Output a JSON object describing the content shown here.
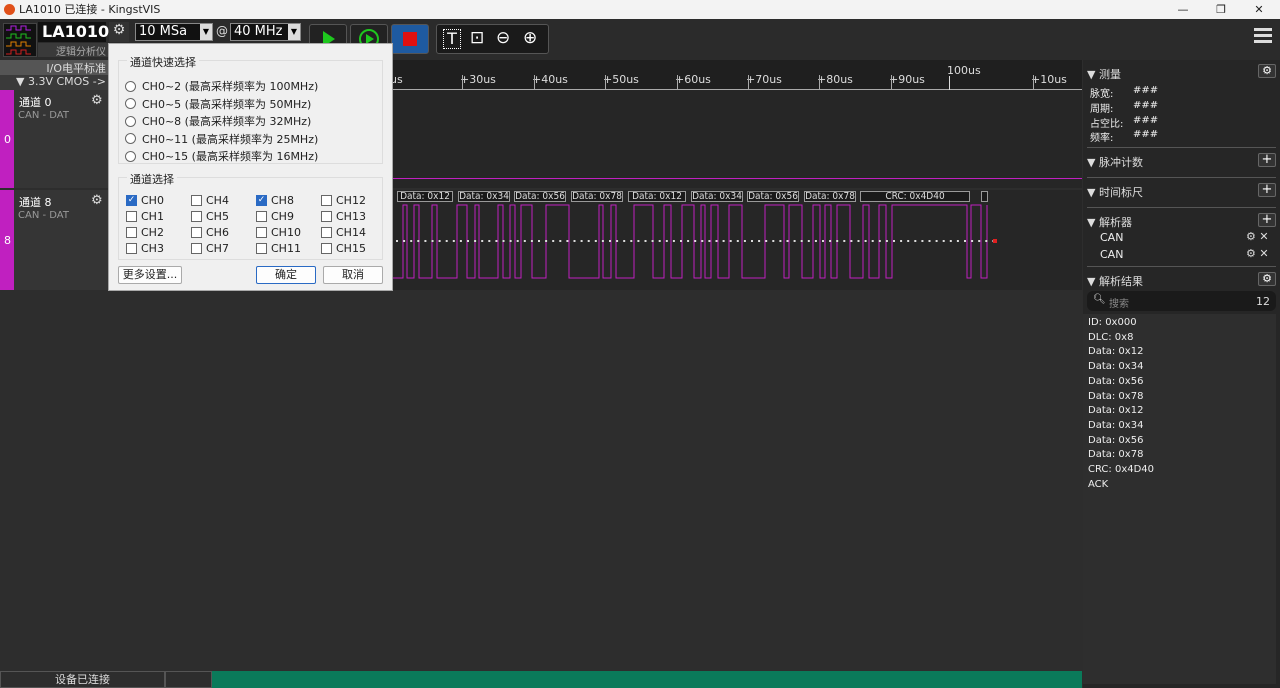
{
  "window": {
    "title": "LA1010 已连接 - KingstVIS",
    "minimize": "—",
    "maximize": "❐",
    "close": "✕"
  },
  "toolbar": {
    "device": "LA1010",
    "device_sub": "逻辑分析仪",
    "sample_depth": "10 MSa",
    "at": "@",
    "sample_rate": "40 MHz"
  },
  "left": {
    "io_standard": "I/O电平标准",
    "voltage": "▼ 3.3V CMOS -> V"
  },
  "channels": [
    {
      "name": "通道 0",
      "sub": "CAN - DAT",
      "index": "0"
    },
    {
      "name": "通道 8",
      "sub": "CAN - DAT",
      "index": "8"
    }
  ],
  "ruler": {
    "labels": [
      "us",
      "+30us",
      "+40us",
      "+50us",
      "+60us",
      "+70us",
      "+80us",
      "+90us",
      "+10us"
    ],
    "major": "100us"
  },
  "decode_labels": [
    "Data: 0x12",
    "Data: 0x34",
    "Data: 0x56",
    "Data: 0x78",
    "Data: 0x12",
    "Data: 0x34",
    "Data: 0x56",
    "Data: 0x78",
    "CRC: 0x4D40"
  ],
  "dialog": {
    "quick_title": "通道快速选择",
    "quick_options": [
      "CH0~2 (最高采样频率为 100MHz)",
      "CH0~5 (最高采样频率为 50MHz)",
      "CH0~8 (最高采样频率为 32MHz)",
      "CH0~11 (最高采样频率为 25MHz)",
      "CH0~15 (最高采样频率为 16MHz)"
    ],
    "channel_title": "通道选择",
    "channels": [
      {
        "label": "CH0",
        "checked": true
      },
      {
        "label": "CH4",
        "checked": false
      },
      {
        "label": "CH8",
        "checked": true
      },
      {
        "label": "CH12",
        "checked": false
      },
      {
        "label": "CH1",
        "checked": false
      },
      {
        "label": "CH5",
        "checked": false
      },
      {
        "label": "CH9",
        "checked": false
      },
      {
        "label": "CH13",
        "checked": false
      },
      {
        "label": "CH2",
        "checked": false
      },
      {
        "label": "CH6",
        "checked": false
      },
      {
        "label": "CH10",
        "checked": false
      },
      {
        "label": "CH14",
        "checked": false
      },
      {
        "label": "CH3",
        "checked": false
      },
      {
        "label": "CH7",
        "checked": false
      },
      {
        "label": "CH11",
        "checked": false
      },
      {
        "label": "CH15",
        "checked": false
      }
    ],
    "more": "更多设置...",
    "ok": "确定",
    "cancel": "取消"
  },
  "right": {
    "measure": "▼ 测量",
    "pulse_width": "脉宽:",
    "period": "周期:",
    "duty": "占空比:",
    "freq": "频率:",
    "value": "###",
    "pulse_count": "▼ 脉冲计数",
    "time_ruler": "▼ 时间标尺",
    "analyzers": "▼ 解析器",
    "analyzer_items": [
      "CAN",
      "CAN"
    ],
    "results": "▼ 解析结果",
    "search_placeholder": "搜索",
    "result_count": "12",
    "result_items": [
      "ID: 0x000",
      "DLC: 0x8",
      "Data: 0x12",
      "Data: 0x34",
      "Data: 0x56",
      "Data: 0x78",
      "Data: 0x12",
      "Data: 0x34",
      "Data: 0x56",
      "Data: 0x78",
      "CRC: 0x4D40",
      "ACK"
    ]
  },
  "status": {
    "text": "设备已连接"
  },
  "colors": {
    "signal": "#c020c0",
    "accent": "#1e5aa0",
    "status_bar": "#0a7a5a"
  }
}
